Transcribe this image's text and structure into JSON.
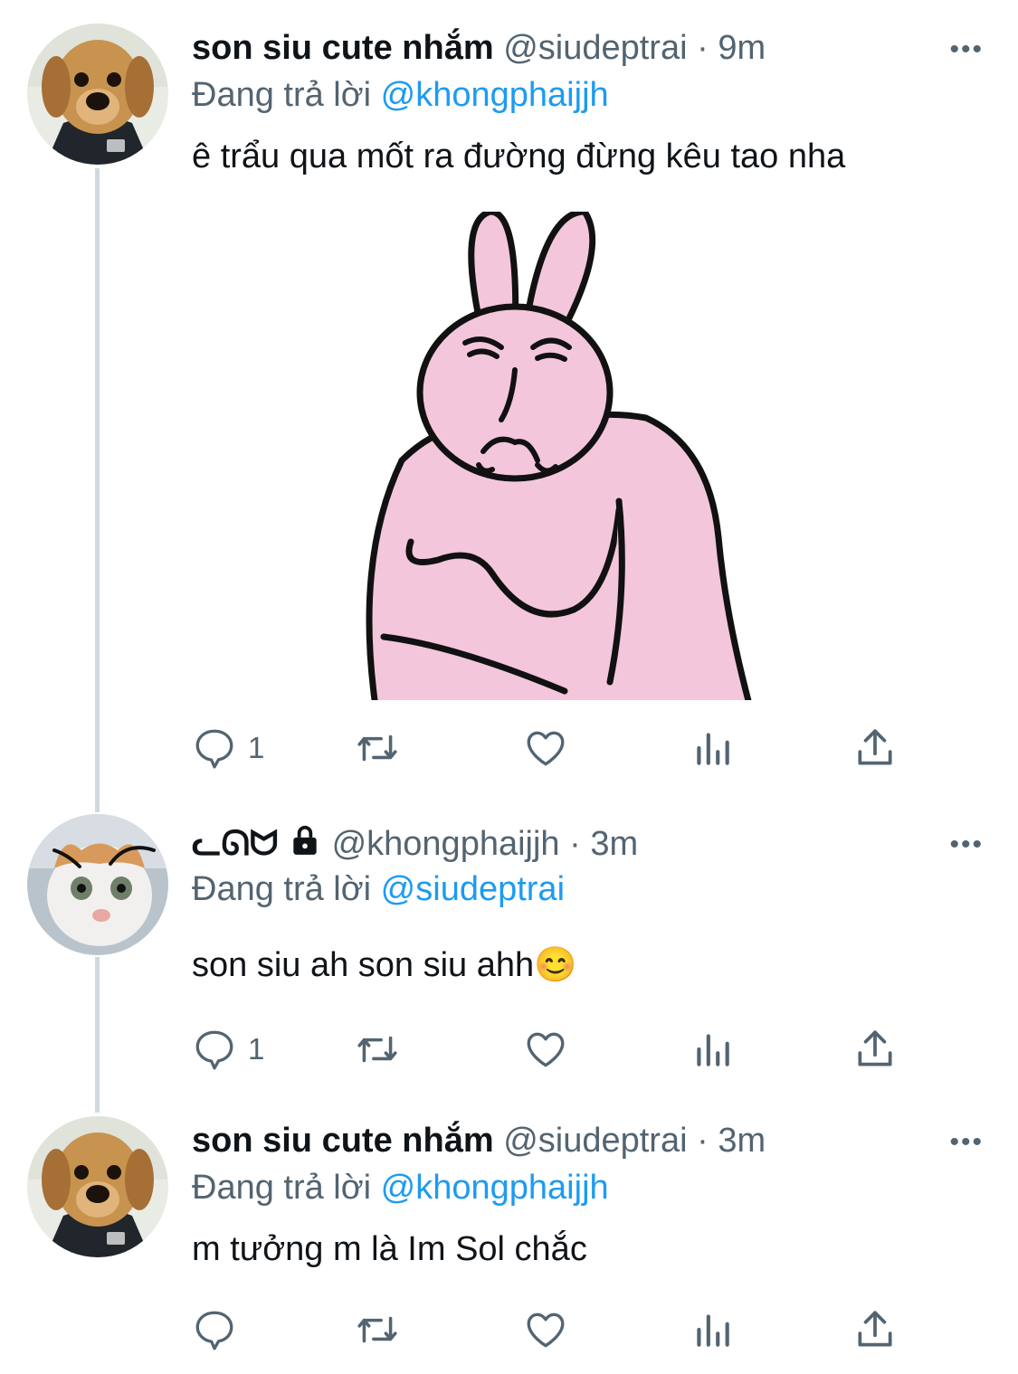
{
  "tweets": [
    {
      "name": "son siu cute nhắm",
      "handle": "@siudeptrai",
      "time": "9m",
      "replying_prefix": "Đang trả lời",
      "replying_to": "@khongphaijjh",
      "text": "ê trẩu qua mốt ra đường đừng kêu tao nha",
      "reply_count": "1",
      "avatar_icon": "dog-avatar",
      "has_media": true
    },
    {
      "name": "ᓚᘏᗢ",
      "handle": "@khongphaijjh",
      "time": "3m",
      "replying_prefix": "Đang trả lời",
      "replying_to": "@siudeptrai",
      "text": "son siu ah son siu ahh😊",
      "reply_count": "1",
      "avatar_icon": "cat-avatar",
      "locked": true
    },
    {
      "name": "son siu cute nhắm",
      "handle": "@siudeptrai",
      "time": "3m",
      "replying_prefix": "Đang trả lời",
      "replying_to": "@khongphaijjh",
      "text": "m tưởng m là Im Sol chắc",
      "reply_count": "",
      "avatar_icon": "dog-avatar"
    }
  ],
  "ui": {
    "separator": "·",
    "more": "•••"
  },
  "colors": {
    "accent": "#1d9bf0",
    "muted": "#536471",
    "text": "#0f1419",
    "thread_line": "#cfd9de"
  }
}
